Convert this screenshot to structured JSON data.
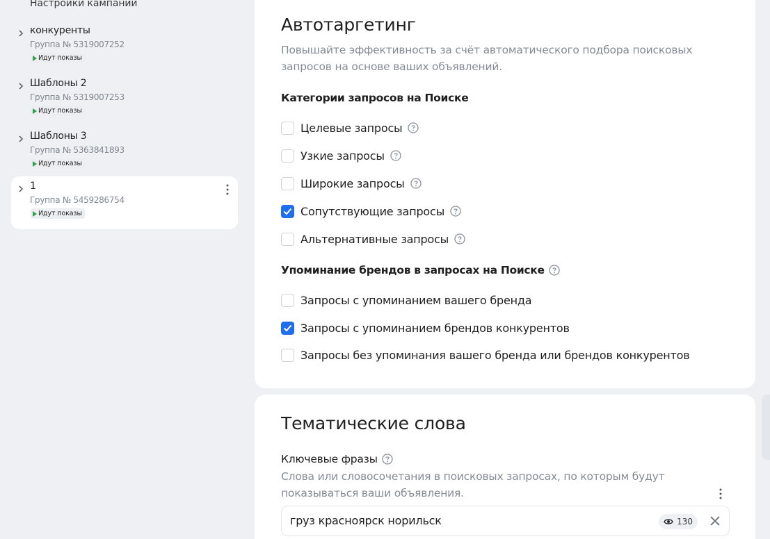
{
  "sidebar": {
    "header": "Настройки кампании",
    "groups": [
      {
        "name": "конкуренты",
        "number": "Группа № 5319007252",
        "status": "Идут показы"
      },
      {
        "name": "Шаблоны 2",
        "number": "Группа № 5319007253",
        "status": "Идут показы"
      },
      {
        "name": "Шаблоны 3",
        "number": "Группа № 5363841893",
        "status": "Идут показы"
      },
      {
        "name": "1",
        "number": "Группа № 5459286754",
        "status": "Идут показы"
      }
    ]
  },
  "autotargeting": {
    "title": "Автотаргетинг",
    "description": "Повышайте эффективность за счёт автоматического подбора поисковых запросов на основе ваших объявлений.",
    "categories_heading": "Категории запросов на Поиске",
    "categories": [
      {
        "label": "Целевые запросы",
        "checked": false
      },
      {
        "label": "Узкие запросы",
        "checked": false
      },
      {
        "label": "Широкие запросы",
        "checked": false
      },
      {
        "label": "Сопутствующие запросы",
        "checked": true
      },
      {
        "label": "Альтернативные запросы",
        "checked": false
      }
    ],
    "brands_heading": "Упоминание брендов в запросах на Поиске",
    "brands": [
      {
        "label": "Запросы с упоминанием вашего бренда",
        "checked": false
      },
      {
        "label": "Запросы с упоминанием брендов конкурентов",
        "checked": true
      },
      {
        "label": "Запросы без упоминания вашего бренда или брендов конкурентов",
        "checked": false
      }
    ]
  },
  "keywords": {
    "title": "Тематические слова",
    "label": "Ключевые фразы",
    "description": "Слова или словосочетания в поисковых запросах, по которым будут показываться ваши объявления.",
    "phrase": "груз красноярск норильск",
    "count": "130"
  },
  "colors": {
    "accent": "#1f6ef0",
    "status_green": "#2aa14b",
    "background": "#eef0f3"
  }
}
